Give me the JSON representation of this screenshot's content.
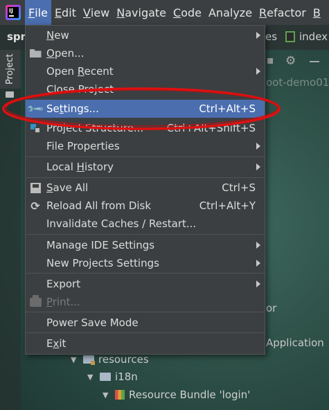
{
  "menubar": {
    "items": [
      {
        "label": "File",
        "mnemonic": "F",
        "rest": "ile"
      },
      {
        "label": "Edit",
        "mnemonic": "E",
        "rest": "dit"
      },
      {
        "label": "View",
        "mnemonic": "V",
        "rest": "iew"
      },
      {
        "label": "Navigate",
        "mnemonic": "N",
        "rest": "avigate"
      },
      {
        "label": "Code",
        "mnemonic": "C",
        "rest": "ode"
      },
      {
        "label": "Analyze",
        "mnemonic": "",
        "rest": "Analyze"
      },
      {
        "label": "Refactor",
        "mnemonic": "R",
        "rest": "efactor"
      },
      {
        "label": "B",
        "mnemonic": "B",
        "rest": ""
      }
    ]
  },
  "background": {
    "project_name": "spr",
    "crumb_tail": "es",
    "crumb_file": "index",
    "side_tab_label": "Project",
    "project_root_fragment": "oot-demo01",
    "frag_or": "or",
    "frag_application": "Application",
    "tree": {
      "resources": "resources",
      "i18n": "i18n",
      "bundle": "Resource Bundle 'login'"
    }
  },
  "file_menu": {
    "items": [
      {
        "pre": "",
        "mn": "N",
        "post": "ew",
        "shortcut": "",
        "submenu": true
      },
      {
        "pre": "",
        "mn": "O",
        "post": "pen...",
        "shortcut": "",
        "submenu": false
      },
      {
        "pre": "Open ",
        "mn": "R",
        "post": "ecent",
        "shortcut": "",
        "submenu": true
      },
      {
        "pre": "Close Project",
        "mn": "",
        "post": "",
        "shortcut": "",
        "submenu": false
      },
      {
        "pre": "Se",
        "mn": "t",
        "post": "tings...",
        "shortcut": "Ctrl+Alt+S",
        "submenu": false
      },
      {
        "pre": "Project Structure...",
        "mn": "",
        "post": "",
        "shortcut": "Ctrl+Alt+Shift+S",
        "submenu": false
      },
      {
        "pre": "File Properties",
        "mn": "",
        "post": "",
        "shortcut": "",
        "submenu": true
      },
      {
        "pre": "Local ",
        "mn": "H",
        "post": "istory",
        "shortcut": "",
        "submenu": true
      },
      {
        "pre": "",
        "mn": "S",
        "post": "ave All",
        "shortcut": "Ctrl+S",
        "submenu": false
      },
      {
        "pre": "Reload All from Disk",
        "mn": "",
        "post": "",
        "shortcut": "Ctrl+Alt+Y",
        "submenu": false
      },
      {
        "pre": "Invalidate Caches / Restart...",
        "mn": "",
        "post": "",
        "shortcut": "",
        "submenu": false
      },
      {
        "pre": "Manage IDE Settings",
        "mn": "",
        "post": "",
        "shortcut": "",
        "submenu": true
      },
      {
        "pre": "New Projects Settings",
        "mn": "",
        "post": "",
        "shortcut": "",
        "submenu": true
      },
      {
        "pre": "Export",
        "mn": "",
        "post": "",
        "shortcut": "",
        "submenu": true
      },
      {
        "pre": "",
        "mn": "P",
        "post": "rint...",
        "shortcut": "",
        "submenu": false
      },
      {
        "pre": "Power Save Mode",
        "mn": "",
        "post": "",
        "shortcut": "",
        "submenu": false
      },
      {
        "pre": "E",
        "mn": "x",
        "post": "it",
        "shortcut": "",
        "submenu": false
      }
    ]
  },
  "colors": {
    "menu_bg": "#3c3f41",
    "selection": "#4b6eaf",
    "annotation": "#e01010"
  }
}
